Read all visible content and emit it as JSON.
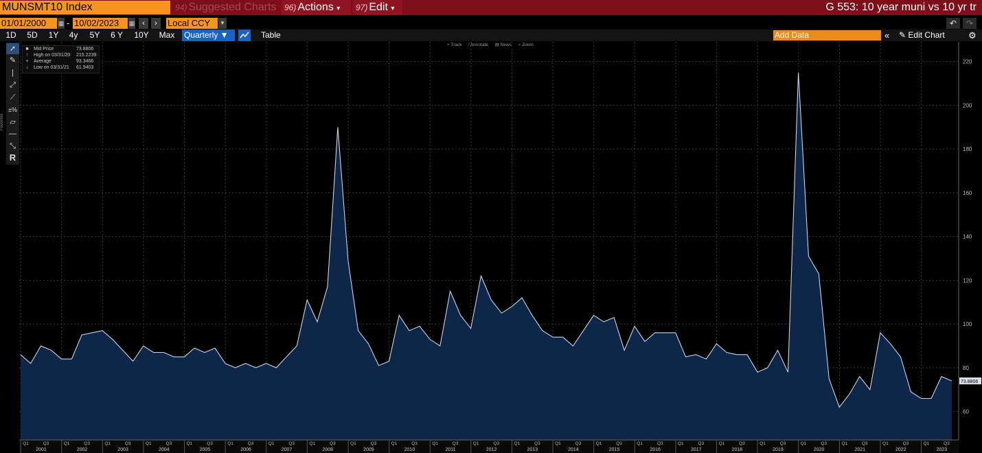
{
  "header": {
    "security": "MUNSMT10 Index",
    "menu": [
      {
        "num": "94)",
        "label": "Suggested Charts"
      },
      {
        "num": "96)",
        "label": "Actions",
        "caret": "▾"
      },
      {
        "num": "97)",
        "label": "Edit",
        "caret": "▾"
      }
    ],
    "chart_title": "G 553: 10 year muni vs 10 yr tr"
  },
  "controls": {
    "start_date": "01/01/2000",
    "date_separator": "-",
    "end_date": "10/02/2023",
    "currency": "Local CCY",
    "ranges": [
      "1D",
      "5D",
      "1Y",
      "4y",
      "5Y",
      "6 Y",
      "10Y",
      "Max"
    ],
    "frequency": "Quarterly ▼",
    "table_label": "Table",
    "add_data_placeholder": "Add Data",
    "collapse_label": "«",
    "edit_chart_label": "Edit Chart",
    "colors": {
      "accent_orange": "#f7931e",
      "header_red": "#7c0f19",
      "active_blue": "#1a63c6"
    }
  },
  "toolbar_left": {
    "favorites_label": "Favorites",
    "tools": [
      "pointer-icon",
      "pen-icon",
      "vertical-line-icon",
      "trend-line-icon",
      "segment-icon",
      "percent-line-icon",
      "channel-icon",
      "horizontal-line-icon",
      "ray-icon",
      "r-tool-icon"
    ]
  },
  "chart_tools": [
    "+ Track",
    "⁄ Annotate",
    "▤ News",
    "⌕ Zoom"
  ],
  "legend": {
    "rows": [
      {
        "marker": "■",
        "label": "Mid Price",
        "value": "73.8806"
      },
      {
        "marker": "↑",
        "label": "High on 03/31/20",
        "value": "215.2239"
      },
      {
        "marker": "+",
        "label": "Average",
        "value": "93.3466"
      },
      {
        "marker": "↓",
        "label": "Low on 03/31/21",
        "value": "61.9403"
      }
    ]
  },
  "chart_data": {
    "type": "area",
    "y_ticks": [
      "60",
      "80",
      "100",
      "120",
      "140",
      "160",
      "180",
      "200",
      "220"
    ],
    "ylim": [
      47,
      229
    ],
    "x_range": [
      "2000-12-31",
      "2023-09-30"
    ],
    "last_value_label": "73.8806",
    "year_labels": [
      "2001",
      "2002",
      "2003",
      "2004",
      "2005",
      "2006",
      "2007",
      "2008",
      "2009",
      "2010",
      "2011",
      "2012",
      "2013",
      "2014",
      "2015",
      "2016",
      "2017",
      "2018",
      "2019",
      "2020",
      "2021",
      "2022",
      "2023"
    ],
    "quarter_labels": [
      "Q1",
      "Q3"
    ],
    "series": [
      {
        "name": "Mid Price",
        "x": [
          "2000-12-31",
          "2001-03-31",
          "2001-06-30",
          "2001-09-30",
          "2001-12-31",
          "2002-03-31",
          "2002-06-30",
          "2002-09-30",
          "2002-12-31",
          "2003-03-31",
          "2003-06-30",
          "2003-09-30",
          "2003-12-31",
          "2004-03-31",
          "2004-06-30",
          "2004-09-30",
          "2004-12-31",
          "2005-03-31",
          "2005-06-30",
          "2005-09-30",
          "2005-12-31",
          "2006-03-31",
          "2006-06-30",
          "2006-09-30",
          "2006-12-31",
          "2007-03-31",
          "2007-06-30",
          "2007-09-30",
          "2007-12-31",
          "2008-03-31",
          "2008-06-30",
          "2008-09-30",
          "2008-12-31",
          "2009-03-31",
          "2009-06-30",
          "2009-09-30",
          "2009-12-31",
          "2010-03-31",
          "2010-06-30",
          "2010-09-30",
          "2010-12-31",
          "2011-03-31",
          "2011-06-30",
          "2011-09-30",
          "2011-12-31",
          "2012-03-31",
          "2012-06-30",
          "2012-09-30",
          "2012-12-31",
          "2013-03-31",
          "2013-06-30",
          "2013-09-30",
          "2013-12-31",
          "2014-03-31",
          "2014-06-30",
          "2014-09-30",
          "2014-12-31",
          "2015-03-31",
          "2015-06-30",
          "2015-09-30",
          "2015-12-31",
          "2016-03-31",
          "2016-06-30",
          "2016-09-30",
          "2016-12-31",
          "2017-03-31",
          "2017-06-30",
          "2017-09-30",
          "2017-12-31",
          "2018-03-31",
          "2018-06-30",
          "2018-09-30",
          "2018-12-31",
          "2019-03-31",
          "2019-06-30",
          "2019-09-30",
          "2019-12-31",
          "2020-03-31",
          "2020-06-30",
          "2020-09-30",
          "2020-12-31",
          "2021-03-31",
          "2021-06-30",
          "2021-09-30",
          "2021-12-31",
          "2022-03-31",
          "2022-06-30",
          "2022-09-30",
          "2022-12-31",
          "2023-03-31",
          "2023-06-30",
          "2023-09-30"
        ],
        "values": [
          86,
          82,
          90,
          88,
          84,
          84,
          95,
          96,
          97,
          93,
          88,
          83,
          90,
          87,
          87,
          85,
          85,
          89,
          87,
          89,
          82,
          80,
          82,
          80,
          82,
          80,
          85,
          90,
          111,
          101,
          117,
          190,
          129,
          97,
          91,
          81,
          83,
          104,
          97,
          99,
          93,
          90,
          115,
          104,
          98,
          122,
          111,
          105,
          108,
          112,
          104,
          97,
          94,
          94,
          90,
          97,
          104,
          101,
          103,
          88,
          99,
          92,
          96,
          96,
          96,
          85,
          86,
          84,
          91,
          87,
          86,
          86,
          78,
          80,
          88,
          78,
          215,
          131,
          123,
          75,
          62,
          68,
          76,
          70,
          96,
          91,
          85,
          69,
          66,
          66,
          76,
          74
        ]
      }
    ]
  }
}
